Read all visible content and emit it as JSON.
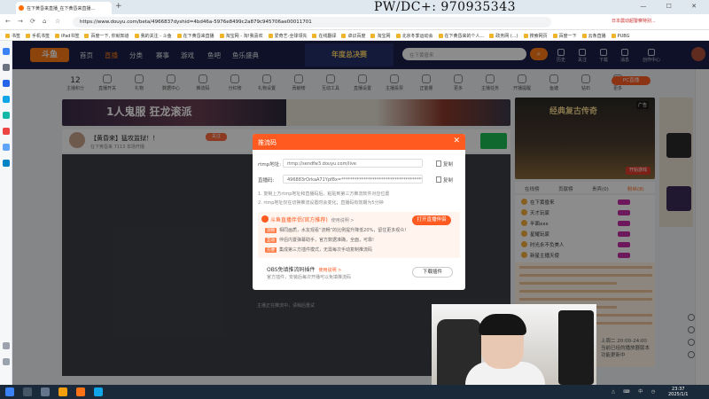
{
  "browser": {
    "tab_title": "在下黄昏来直播_在下黄昏来直播...",
    "new_tab": "+",
    "url": "https://www.douyu.com/beta/4966837dyshid=4bd46a-5976e8499c2a879c945706ae00011701",
    "addr_right": "日本震动超警察特别...",
    "window_controls": "— ☐ ✕",
    "bookmarks": [
      "书签",
      "手机书签",
      "iPad书签",
      "百度一下, 你就知道",
      "我的关注 - 斗鱼",
      "在下黄昏来直播",
      "淘宝网 - 淘!我喜欢",
      "爱奇艺-全球领先",
      "在线翻译",
      "卓识百度",
      "淘宝网",
      "北京冬季运动会",
      "在下黄昏来的个人...",
      "政务网 (...)",
      "搜索网页",
      "百度一下",
      "云条直播",
      "PUBG"
    ]
  },
  "watermark": "PW/DC+:   970935343",
  "header": {
    "logo": "斗鱼",
    "nav": [
      "首页",
      "直播",
      "分类",
      "赛事",
      "游戏",
      "鱼吧",
      "鱼乐盛典"
    ],
    "event": "年度总决赛",
    "search_placeholder": "在下黄昏来",
    "search_icon": "search-icon",
    "right": [
      "历史",
      "关注",
      "下载",
      "消息",
      "创作中心"
    ]
  },
  "toolbar": {
    "count": "12",
    "count_label": "主播积分",
    "items": [
      "直播开关",
      "礼物",
      "数据中心",
      "推流码",
      "分红榜",
      "礼物设置",
      "贡献榜",
      "互动工具",
      "直播设置",
      "主播投票",
      "正能量",
      "更多",
      "主播任务",
      "开播提醒",
      "鱼塘",
      "钻石",
      "更多"
    ],
    "pc_button": "PC直播"
  },
  "ad": {
    "text": "1人鬼服 狂龙滚派"
  },
  "streamer": {
    "title": "【黄昏来】猛攻监狱！！",
    "stats": "87566",
    "follow": "关注",
    "sub": "在下黄昏来   7113   本场开播"
  },
  "player": {
    "message": "主播正在推流中，请稍后重试"
  },
  "side_ad": {
    "tag": "广告",
    "title": "经典复古传奇",
    "button": "开始游戏"
  },
  "right_tabs": [
    "在线榜",
    "贡献榜",
    "贵宾(0)",
    "粉丝(8)"
  ],
  "rank_rows": [
    "在下黄昏来",
    "天才玩家",
    "半面xxx",
    "星耀玩家",
    "时光永不负美人",
    "新星主播天使"
  ],
  "chat_notes": [
    "上周二 20:00-24:00",
    "当前已经的播放器版本",
    "功能更新中"
  ],
  "modal": {
    "title": "推流码",
    "close": "✕",
    "rtmp_label": "rtmp地址:",
    "rtmp_value": "rtmp://sendfw3.douyu.com/live",
    "key_label": "直播码:",
    "key_value": "496883rOrkaA71Ypf8x=*************************************&dyrecord=0",
    "copy": "复制",
    "hint1": "1. 复制上方rtmp地址和直播码后，粘贴到第三方推流软件对应位置",
    "hint2": "2. rtmp地址仅在切换推流设置时会变化；直播码有效期为5分钟",
    "plugin_title": "斗鱼直播伴侣(官方推荐)",
    "plugin_link": "使用说明 >",
    "open_button": "打开直播伴侣",
    "features": [
      {
        "tag": "流畅",
        "text": "相同画质，水友观看“流畅”的比例提升降低20%，留住更多观众!"
      },
      {
        "tag": "互动",
        "text": "伴侣内置弹幕助手，官方数据准确，全面，可靠!"
      },
      {
        "tag": "方便",
        "text": "集成第三方插件模式，无需每次手动复制推流码"
      }
    ],
    "obs_title": "OBS免填推流码插件",
    "obs_link": "使用说明 >",
    "obs_desc": "官方插件，安装后每次开播可以免填推流码",
    "download_button": "下载插件"
  },
  "taskbar": {
    "time": "23:37",
    "date": "2025/1/1",
    "tray": "△ ⌨ 中 ◷"
  },
  "colors": {
    "accent": "#ff5a1f",
    "header": "#1a1f48",
    "taskbar": "#1b2a3a"
  }
}
